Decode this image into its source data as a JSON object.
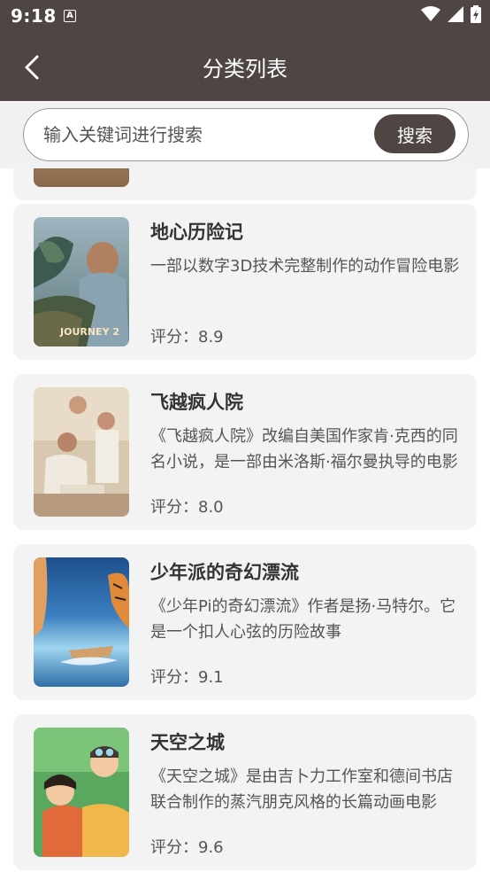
{
  "status_bar": {
    "time": "9:18",
    "app_icon_letter": "A"
  },
  "header": {
    "title": "分类列表"
  },
  "search": {
    "placeholder": "输入关键词进行搜索",
    "button_label": "搜索"
  },
  "movies": [
    {
      "title": "地心历险记",
      "description": "一部以数字3D技术完整制作的动作冒险电影",
      "rating": "评分：8.9",
      "poster_text": "JOURNEY 2"
    },
    {
      "title": "飞越疯人院",
      "description": "《飞越疯人院》改编自美国作家肯·克西的同名小说，是一部由米洛斯·福尔曼执导的电影",
      "rating": "评分：8.0"
    },
    {
      "title": "少年派的奇幻漂流",
      "description": "《少年Pi的奇幻漂流》作者是扬·马特尔。它是一个扣人心弦的历险故事",
      "rating": "评分：9.1"
    },
    {
      "title": "天空之城",
      "description": "《天空之城》是由吉卜力工作室和德间书店联合制作的蒸汽朋克风格的长篇动画电影",
      "rating": "评分：9.6"
    }
  ],
  "colors": {
    "primary": "#4f4644",
    "card_background": "#f4f3f3",
    "search_background": "#f2f1f1"
  }
}
